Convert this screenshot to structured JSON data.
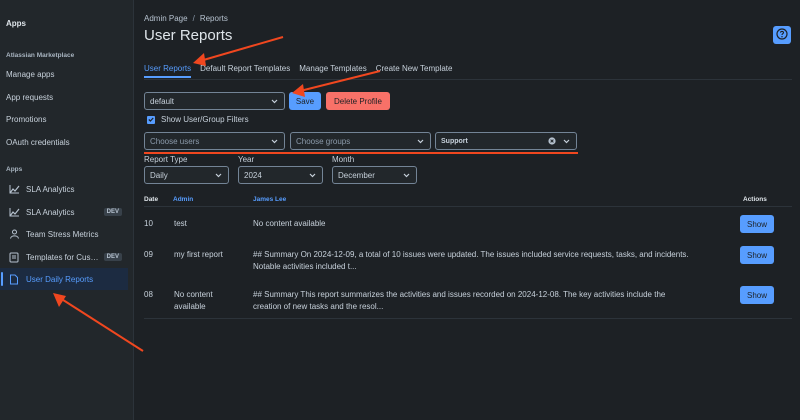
{
  "sidebar": {
    "apps_title": "Apps",
    "marketplace_heading": "Atlassian Marketplace",
    "marketplace_links": [
      "Manage apps",
      "App requests",
      "Promotions",
      "OAuth credentials"
    ],
    "apps_heading": "Apps",
    "app_items": [
      {
        "label": "SLA Analytics",
        "icon": "chart-line-icon",
        "badge": ""
      },
      {
        "label": "SLA Analytics",
        "icon": "chart-line-icon",
        "badge": "DEV"
      },
      {
        "label": "Team Stress Metrics",
        "icon": "team-icon",
        "badge": ""
      },
      {
        "label": "Templates for Cus…",
        "icon": "template-icon",
        "badge": "DEV"
      },
      {
        "label": "User Daily Reports",
        "icon": "document-icon",
        "badge": ""
      }
    ]
  },
  "header": {
    "breadcrumb": [
      "Admin Page",
      "Reports"
    ],
    "separator": "/",
    "title": "User Reports",
    "help_icon": "question-circle-icon"
  },
  "tabs": [
    "User Reports",
    "Default Report Templates",
    "Manage Templates",
    "Create New Template"
  ],
  "profile": {
    "selected": "default",
    "save_label": "Save",
    "delete_label": "Delete Profile"
  },
  "filters": {
    "toggle_label": "Show User/Group Filters",
    "users_placeholder": "Choose users",
    "groups_placeholder": "Choose groups",
    "project_value": "Support"
  },
  "period": {
    "report_type_label": "Report Type",
    "report_type_value": "Daily",
    "year_label": "Year",
    "year_value": "2024",
    "month_label": "Month",
    "month_value": "December"
  },
  "table": {
    "headers": [
      "Date",
      "Admin",
      "James Lee",
      "Actions"
    ],
    "rows": [
      {
        "date": "10",
        "admin": "test",
        "content": "No content available",
        "action": "Show"
      },
      {
        "date": "09",
        "admin": "my first report",
        "content_lines": [
          "## Summary On 2024-12-09, a total of 10 issues were updated. The issues included service requests, tasks, and incidents.",
          "Notable activities included t..."
        ],
        "action": "Show"
      },
      {
        "date": "08",
        "admin_lines": [
          "No content",
          "available"
        ],
        "content_lines": [
          "## Summary This report summarizes the activities and issues recorded on 2024-12-08. The key activities include the",
          "creation of new tasks and the resol..."
        ],
        "action": "Show"
      }
    ]
  },
  "colors": {
    "accent": "#579dff",
    "danger": "#f87168",
    "annotation": "#f0471f",
    "background": "#1d2125"
  }
}
